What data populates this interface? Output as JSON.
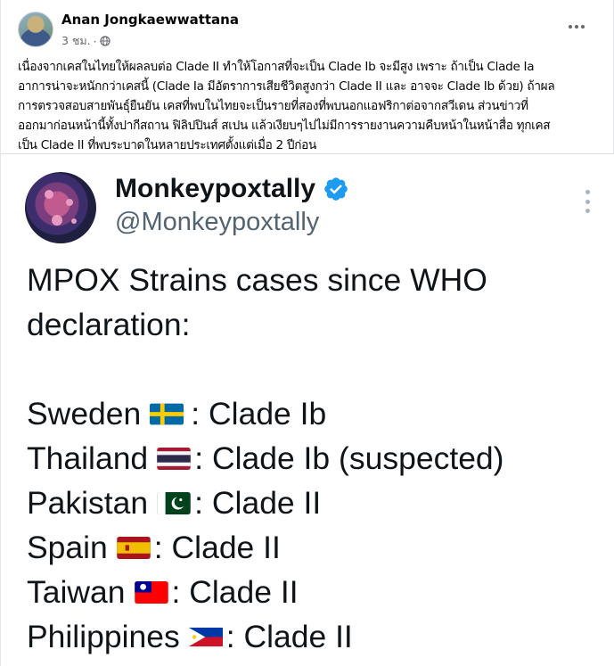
{
  "post": {
    "author": "Anan Jongkaewwattana",
    "time": "3 ชม.",
    "dot": "·",
    "caption_lines": [
      "เนื่องจากเคสในไทยให้ผลลบต่อ Clade II ทำให้โอกาสที่จะเป็น Clade Ib จะมีสูง เพราะ ถ้าเป็น Clade Ia",
      "อาการน่าจะหนักกว่าเคสนี้ (Clade Ia มีอัตราการเสียชีวิตสูงกว่า Clade II และ อาจจะ Clade Ib ด้วย) ถ้าผล",
      "การตรวจสอบสายพันธุ์ยืนยัน เคสที่พบในไทยจะเป็นรายที่สองที่พบนอกแอฟริกาต่อจากสวีเดน ส่วนข่าวที่",
      "ออกมาก่อนหน้านี้ทั้งปากีสถาน ฟิลิปปินส์ สเปน แล้วเงียบๆไปไม่มีการรายงานความคืบหน้าในหน้าสื่อ ทุกเคส",
      "เป็น Clade II ที่พบระบาดในหลายประเทศตั้งแต่เมื่อ 2 ปีก่อน"
    ],
    "icons": {
      "privacy": "globe-icon",
      "menu": "more-horizontal-icon"
    }
  },
  "tweet": {
    "name": "Monkeypoxtally",
    "handle": "@Monkeypoxtally",
    "icons": {
      "verified": "verified-badge-icon",
      "menu": "more-vertical-icon"
    },
    "colors": {
      "verified": "#1d9bf0",
      "name": "#0f1419",
      "handle": "#536471"
    },
    "heading_line1": "MPOX Strains cases since WHO",
    "heading_line2": "declaration:",
    "rows": [
      {
        "country": "Sweden",
        "flag": "sweden",
        "clade": "Clade Ib"
      },
      {
        "country": "Thailand",
        "flag": "thailand",
        "clade": "Clade Ib (suspected)"
      },
      {
        "country": "Pakistan",
        "flag": "pakistan",
        "clade": "Clade II"
      },
      {
        "country": "Spain",
        "flag": "spain",
        "clade": "Clade II"
      },
      {
        "country": "Taiwan",
        "flag": "taiwan",
        "clade": "Clade II"
      },
      {
        "country": "Philippines",
        "flag": "philippines",
        "clade": "Clade II"
      }
    ],
    "separator": ":"
  }
}
